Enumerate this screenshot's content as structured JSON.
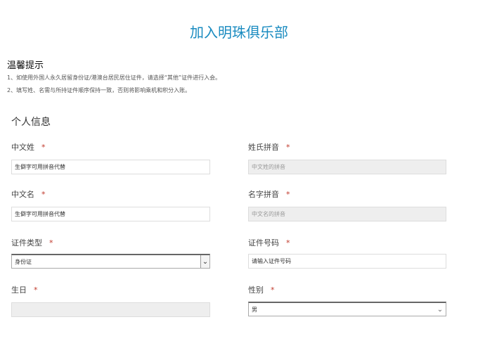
{
  "title": "加入明珠俱乐部",
  "notice": {
    "heading": "温馨提示",
    "lines": [
      "1、如使用外国人永久居留身份证/港澳台居民居住证件，请选择“其他”证件进行入会。",
      "2、填写姓、名需与所持证件顺序保持一致，否则将影响乘机和积分入账。"
    ]
  },
  "section": "个人信息",
  "required_mark": "*",
  "fields": {
    "surname": {
      "label": "中文姓",
      "value": "生僻字可用拼音代替"
    },
    "surname_pinyin": {
      "label": "姓氏拼音",
      "placeholder": "中文姓的拼音"
    },
    "given": {
      "label": "中文名",
      "value": "生僻字可用拼音代替"
    },
    "given_pinyin": {
      "label": "名字拼音",
      "placeholder": "中文名的拼音"
    },
    "id_type": {
      "label": "证件类型",
      "value": "身份证"
    },
    "id_number": {
      "label": "证件号码",
      "placeholder": "请输入证件号码"
    },
    "birthday": {
      "label": "生日",
      "value": ""
    },
    "gender": {
      "label": "性别",
      "value": "男"
    }
  }
}
